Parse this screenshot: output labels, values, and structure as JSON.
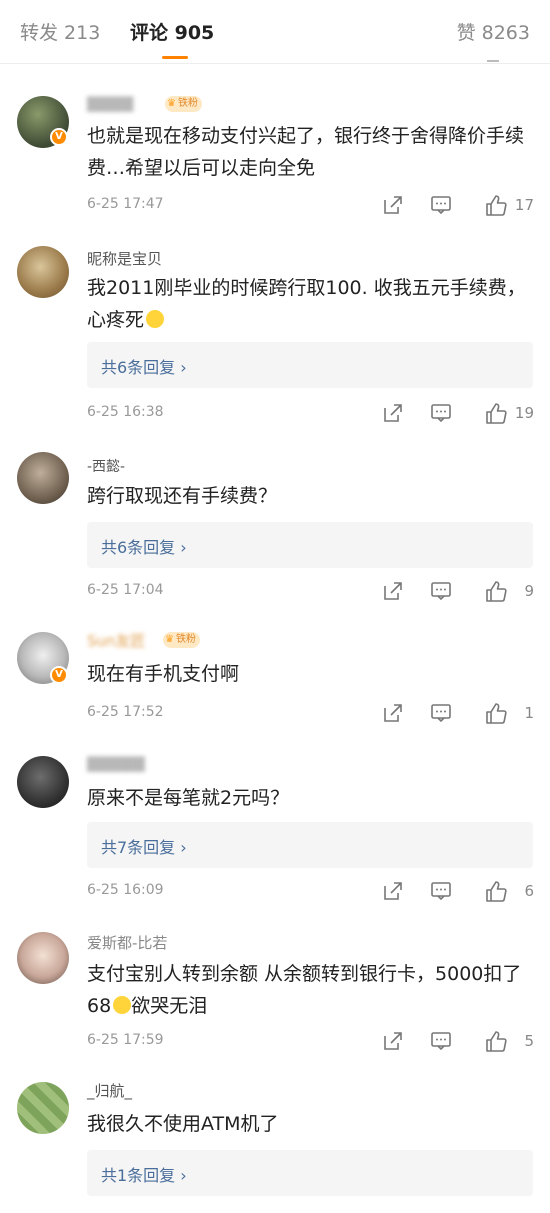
{
  "tabs": {
    "forward": "转发 213",
    "comments": "评论 905",
    "likes": "赞 8263"
  },
  "comments": [
    {
      "username": "",
      "fan_badge": "铁粉",
      "text": "也就是现在移动支付兴起了，银行终于舍得降价手续费…希望以后可以走向全免",
      "time": "6-25 17:47",
      "likes": "17",
      "reply": ""
    },
    {
      "username": "昵称是宝贝",
      "fan_badge": "",
      "text": "我2011刚毕业的时候跨行取100. 收我五元手续费，心疼死",
      "time": "6-25 16:38",
      "likes": "19",
      "reply": "共6条回复 ›"
    },
    {
      "username": "-西懿-",
      "fan_badge": "",
      "text": "跨行取现还有手续费？",
      "time": "6-25 17:04",
      "likes": "9",
      "reply": "共6条回复 ›"
    },
    {
      "username": "Sun友匠",
      "fan_badge": "铁粉",
      "text": "现在有手机支付啊",
      "time": "6-25 17:52",
      "likes": "1",
      "reply": ""
    },
    {
      "username": "",
      "fan_badge": "",
      "text": "原来不是每笔就2元吗？",
      "time": "6-25 16:09",
      "likes": "6",
      "reply": "共7条回复 ›"
    },
    {
      "username": "爱斯都-比若",
      "fan_badge": "",
      "text": "支付宝别人转到余额 从余额转到银行卡，5000扣了68",
      "text_tail": "欲哭无泪",
      "time": "6-25 17:59",
      "likes": "5",
      "reply": ""
    },
    {
      "username": "_归航_",
      "fan_badge": "",
      "text": "我很久不使用ATM机了",
      "time": "",
      "likes": "",
      "reply": "共1条回复 ›"
    }
  ],
  "colors": {
    "accent": "#ff8200",
    "link": "#4a6e9b",
    "badge": "#ff8c00"
  }
}
